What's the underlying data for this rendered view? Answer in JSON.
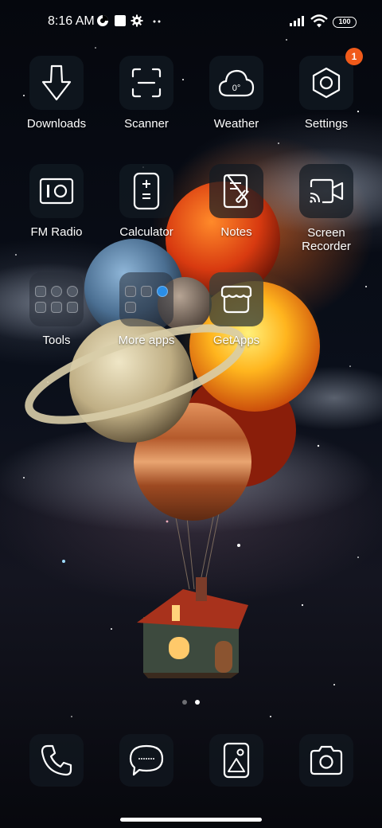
{
  "status_bar": {
    "time": "8:16 AM",
    "icons": [
      "data-saver-icon",
      "notification-square-icon",
      "settings-gear-icon",
      "more-dots-icon",
      "signal-icon",
      "wifi-icon"
    ],
    "battery": "100"
  },
  "apps": [
    {
      "name": "downloads",
      "label": "Downloads",
      "icon": "download-arrow-icon"
    },
    {
      "name": "scanner",
      "label": "Scanner",
      "icon": "scan-frame-icon"
    },
    {
      "name": "weather",
      "label": "Weather",
      "icon": "cloud-icon",
      "icon_text": "0°"
    },
    {
      "name": "settings",
      "label": "Settings",
      "icon": "hexagon-gear-icon",
      "badge": "1"
    },
    {
      "name": "fm-radio",
      "label": "FM Radio",
      "icon": "radio-icon"
    },
    {
      "name": "calculator",
      "label": "Calculator",
      "icon": "calculator-icon"
    },
    {
      "name": "notes",
      "label": "Notes",
      "icon": "notes-pen-icon"
    },
    {
      "name": "screen-recorder",
      "label": "Screen\nRecorder",
      "icon": "video-camera-icon"
    },
    {
      "name": "tools",
      "label": "Tools",
      "icon": "folder-icon"
    },
    {
      "name": "more-apps",
      "label": "More apps",
      "icon": "folder-icon"
    },
    {
      "name": "getapps",
      "label": "GetApps",
      "icon": "store-icon"
    }
  ],
  "page_indicator": {
    "pages": 2,
    "current": 2
  },
  "dock": [
    {
      "name": "phone",
      "icon": "phone-icon"
    },
    {
      "name": "messages",
      "icon": "chat-bubble-icon"
    },
    {
      "name": "gallery",
      "icon": "gallery-icon"
    },
    {
      "name": "camera",
      "icon": "camera-icon"
    }
  ],
  "colors": {
    "badge": "#f05a1a",
    "tile_bg": "#121a22"
  }
}
